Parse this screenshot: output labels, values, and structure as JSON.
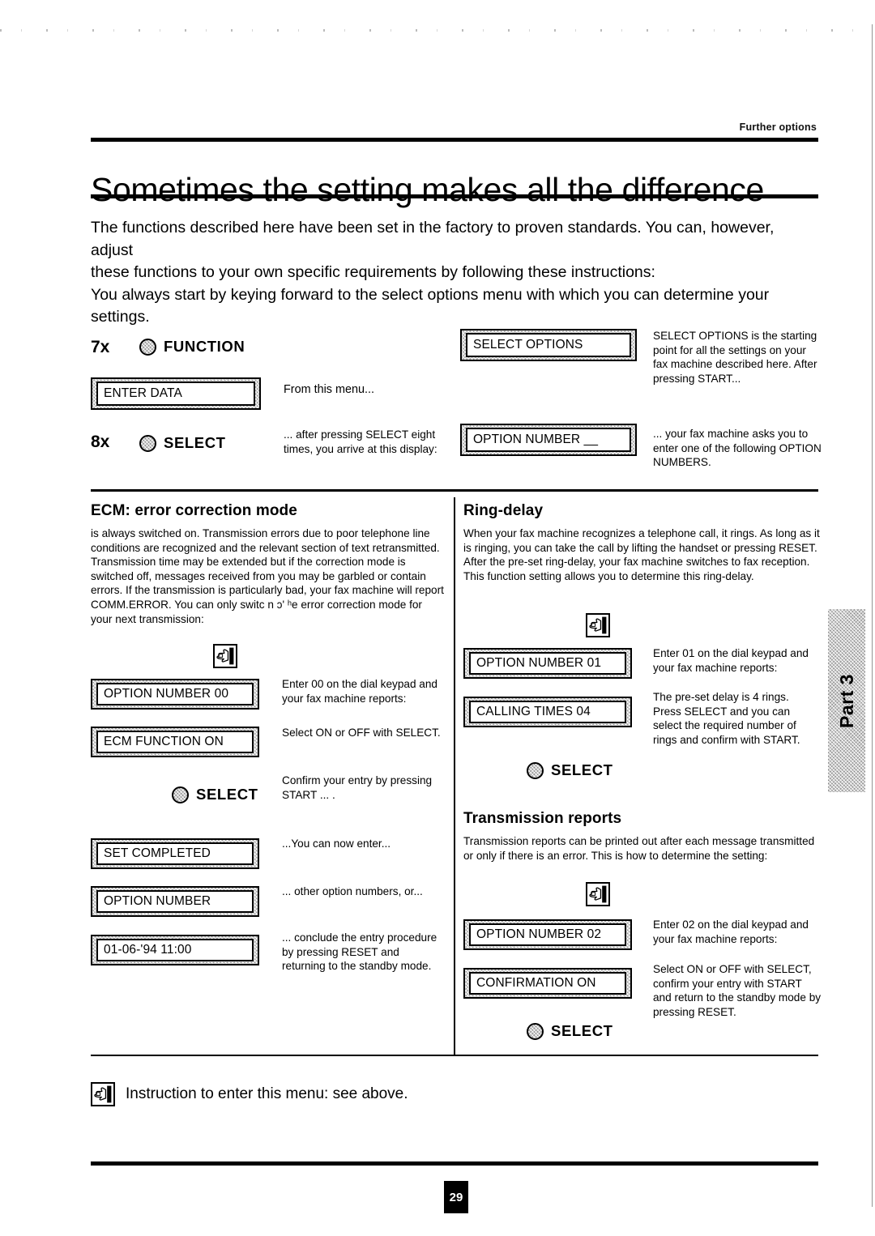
{
  "header": {
    "running_head": "Further options",
    "chapter_title": "Sometimes the setting makes all the difference"
  },
  "intro": {
    "line1": "The functions described here have been set in the factory to proven standards.  You can, however, adjust",
    "line2": "these functions to your own specific requirements by following these instructions:",
    "line3": "You always start by keying forward to the select options menu with which you can determine your",
    "line4": "settings."
  },
  "entry_procedure": {
    "step1_count": "7x",
    "step1_key": "FUNCTION",
    "step1_display": "ENTER DATA",
    "step1_caption": "From this menu...",
    "step2_count": "8x",
    "step2_key": "SELECT",
    "step2_caption": "... after pressing SELECT eight times, you arrive at this display:",
    "display_select_options": "SELECT OPTIONS",
    "select_options_note": "SELECT OPTIONS is the starting point for all the settings on your fax machine described here.  After pressing START...",
    "display_option_number": "OPTION NUMBER __",
    "option_number_note": "... your fax machine asks you to enter one of the following OPTION NUMBERS."
  },
  "ecm": {
    "heading": "ECM: error correction mode",
    "body": "is always switched on.  Transmission errors due to poor telephone line conditions are recognized and the relevant section of text retransmitted.  Transmission time may be extended but if the correction mode is switched off, messages received from you may be garbled or contain errors.  If the transmission is particularly bad, your fax machine will report COMM.ERROR. You can only switc n ɔʹ ʰe error correction mode for your next transmission:",
    "display_option": "OPTION NUMBER 00",
    "note_option": "Enter 00 on the dial keypad and your fax machine reports:",
    "display_function": "ECM FUNCTION ON",
    "note_function": "Select ON or OFF with SELECT.",
    "key_select": "SELECT",
    "note_confirm": "Confirm your entry by pressing START ... .",
    "display_set_completed": "SET COMPLETED",
    "note_set_completed": "...You can now enter...",
    "display_option_number": "OPTION NUMBER",
    "note_option_number": "... other option numbers, or...",
    "display_standby": "01-06-'94 11:00",
    "note_standby": "... conclude the entry procedure by pressing RESET and returning to the standby mode."
  },
  "ring_delay": {
    "heading": "Ring-delay",
    "body": "When your fax machine recognizes a telephone call, it rings.  As long as it is ringing, you can take the call by lifting the handset or pressing RESET.  After the pre-set ring-delay, your fax machine switches to fax reception.  This function setting allows you to determine this ring-delay.",
    "display_option": "OPTION NUMBER 01",
    "note_option": "Enter 01 on the dial keypad and your fax machine reports:",
    "display_calling_times": "CALLING TIMES 04",
    "note_calling_times": "The pre-set delay is 4 rings. Press SELECT and you can select the required number of rings and confirm with START.",
    "key_select": "SELECT"
  },
  "transmission_reports": {
    "heading": "Transmission reports",
    "body": "Transmission reports can be printed out after each message transmitted or only if there is an error.  This is how to determine the setting:",
    "display_option": "OPTION NUMBER 02",
    "note_option": "Enter 02 on the dial keypad and your fax machine reports:",
    "display_confirmation": "CONFIRMATION ON",
    "note_confirmation": "Select ON or OFF with SELECT, confirm your entry with START and return to the standby mode by pressing RESET.",
    "key_select": "SELECT"
  },
  "footer": {
    "note": "Instruction to enter this menu: see above.",
    "page_number": "29"
  },
  "side_tab": {
    "label": "Part 3"
  }
}
